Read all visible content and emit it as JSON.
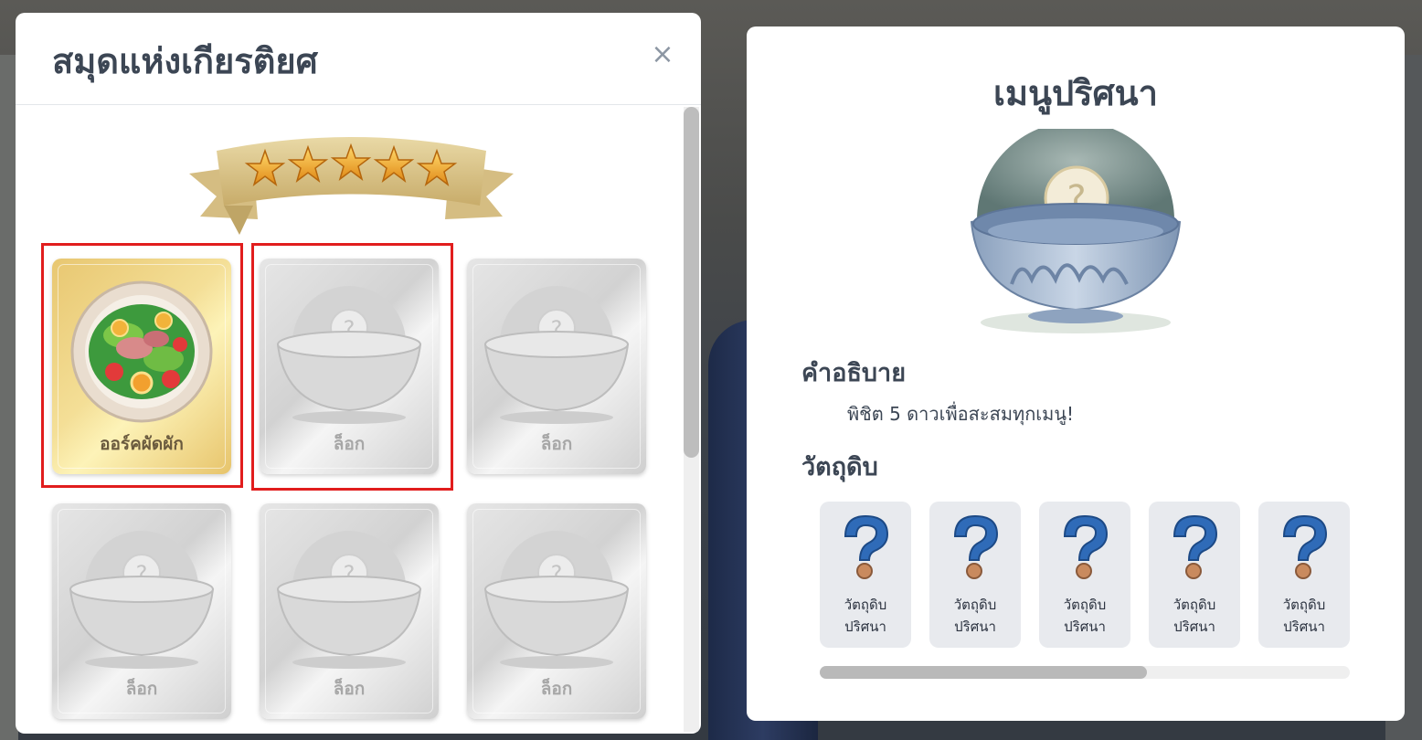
{
  "book": {
    "title": "สมุดแห่งเกียรติยศ",
    "close_icon": "×",
    "star_rating": 5,
    "cards": [
      {
        "label": "ออร์คผัดผัก",
        "state": "unlocked",
        "icon": "salad-dish"
      },
      {
        "label": "ล็อก",
        "state": "locked",
        "icon": "mystery-bowl"
      },
      {
        "label": "ล็อก",
        "state": "locked",
        "icon": "mystery-bowl"
      },
      {
        "label": "ล็อก",
        "state": "locked",
        "icon": "mystery-bowl"
      },
      {
        "label": "ล็อก",
        "state": "locked",
        "icon": "mystery-bowl"
      },
      {
        "label": "ล็อก",
        "state": "locked",
        "icon": "mystery-bowl"
      }
    ]
  },
  "detail": {
    "title": "เมนูปริศนา",
    "description_heading": "คำอธิบาย",
    "description": "พิชิต 5 ดาวเพื่อสะสมทุกเมนู!",
    "ingredients_heading": "วัตถุดิบ",
    "ingredients": [
      {
        "line1": "วัตถุดิบ",
        "line2": "ปริศนา",
        "icon": "question-mark"
      },
      {
        "line1": "วัตถุดิบ",
        "line2": "ปริศนา",
        "icon": "question-mark"
      },
      {
        "line1": "วัตถุดิบ",
        "line2": "ปริศนา",
        "icon": "question-mark"
      },
      {
        "line1": "วัตถุดิบ",
        "line2": "ปริศนา",
        "icon": "question-mark"
      },
      {
        "line1": "วัตถุดิบ",
        "line2": "ปริศนา",
        "icon": "question-mark"
      }
    ]
  },
  "colors": {
    "highlight": "#e11d1d",
    "title_text": "#3c4654",
    "gold_card": "#f4df97"
  }
}
